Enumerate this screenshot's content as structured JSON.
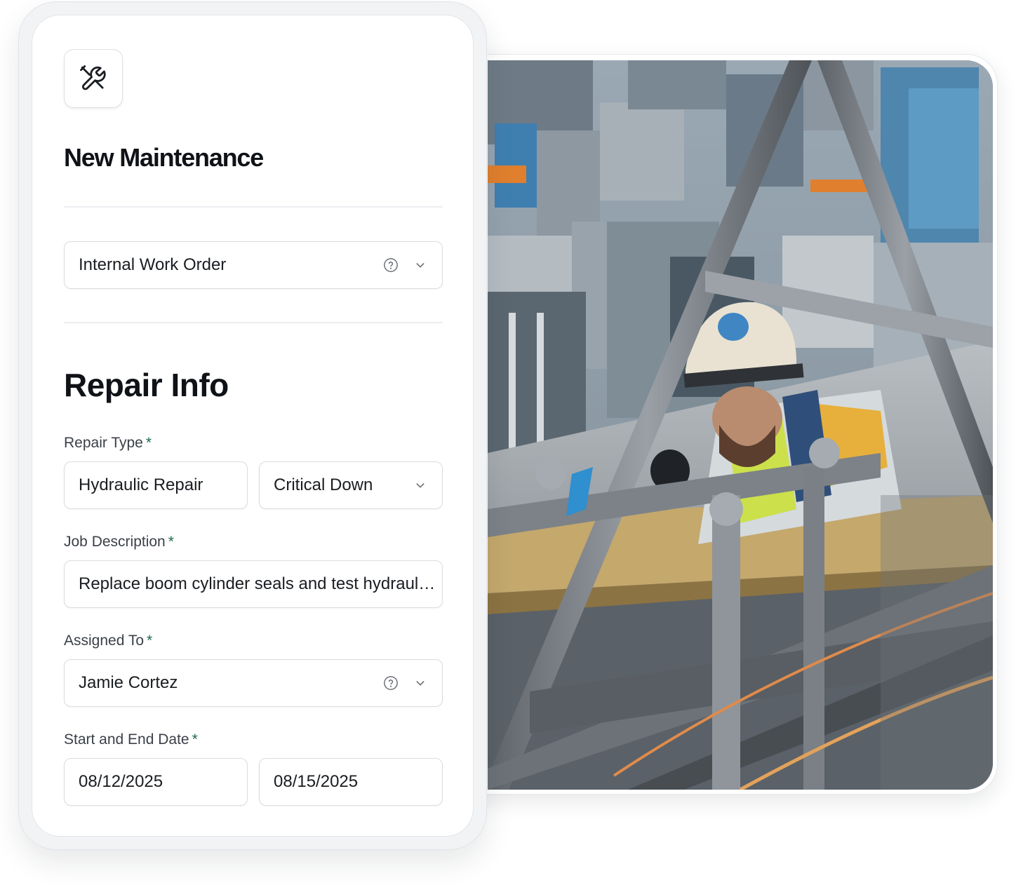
{
  "form": {
    "title": "New Maintenance",
    "work_order_type": "Internal Work Order",
    "section_title": "Repair Info",
    "repair_type": {
      "label": "Repair Type",
      "required_mark": "*",
      "type_value": "Hydraulic Repair",
      "severity_value": "Critical Down"
    },
    "job_description": {
      "label": "Job Description",
      "required_mark": "*",
      "value": "Replace boom cylinder seals and test hydraulic system"
    },
    "assigned_to": {
      "label": "Assigned To",
      "required_mark": "*",
      "value": "Jamie Cortez"
    },
    "dates": {
      "label": "Start and End Date",
      "required_mark": "*",
      "start": "08/12/2025",
      "end": "08/15/2025"
    }
  },
  "icons": {
    "app_icon": "wrench-screwdriver-icon",
    "help": "help-circle-icon",
    "dropdown": "chevron-down-icon"
  },
  "colors": {
    "required_mark": "#1d6b4e",
    "field_border": "#d9dce1",
    "text": "#111418"
  }
}
